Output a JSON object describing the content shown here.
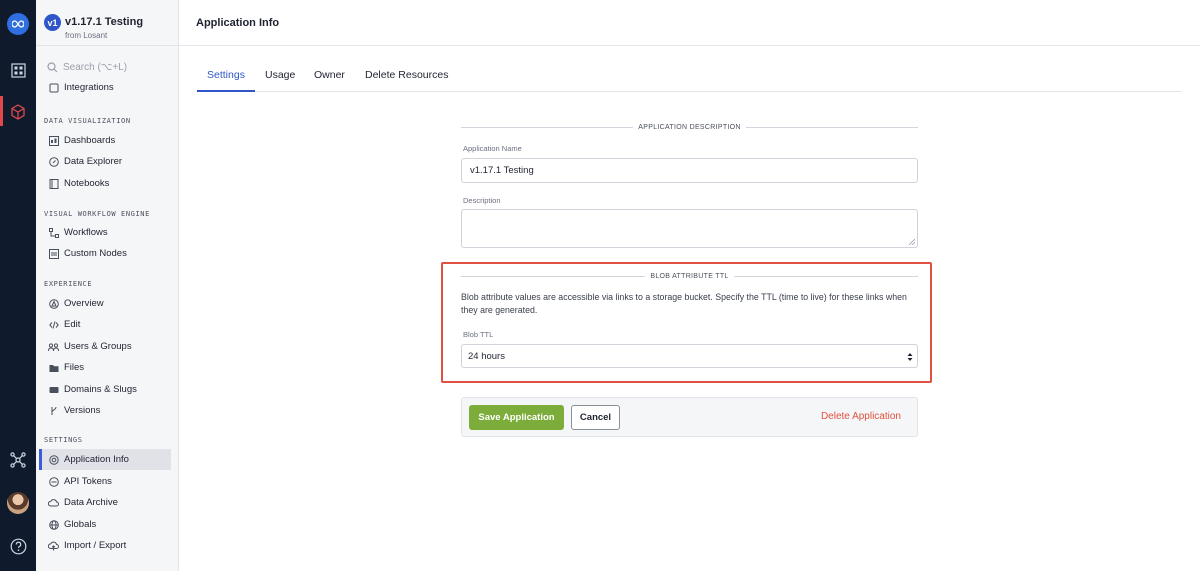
{
  "app": {
    "badge": "v1",
    "name": "v1.17.1 Testing",
    "owner": "from Losant"
  },
  "search": {
    "placeholder": "Search (⌥+L)"
  },
  "sidebar": {
    "partial_item": "Integrations",
    "sections": {
      "data_visualization": "DATA VISUALIZATION",
      "visual_workflow": "VISUAL WORKFLOW ENGINE",
      "experience": "EXPERIENCE",
      "settings": "SETTINGS"
    },
    "items": {
      "dashboards": "Dashboards",
      "data_explorer": "Data Explorer",
      "notebooks": "Notebooks",
      "workflows": "Workflows",
      "custom_nodes": "Custom Nodes",
      "overview": "Overview",
      "edit": "Edit",
      "users_groups": "Users & Groups",
      "files": "Files",
      "domains_slugs": "Domains & Slugs",
      "versions": "Versions",
      "application_info": "Application Info",
      "api_tokens": "API Tokens",
      "data_archive": "Data Archive",
      "globals": "Globals",
      "import_export": "Import / Export"
    }
  },
  "header": {
    "title": "Application Info"
  },
  "tabs": {
    "settings": "Settings",
    "usage": "Usage",
    "owner": "Owner",
    "delete_resources": "Delete Resources"
  },
  "form": {
    "section_description": "APPLICATION DESCRIPTION",
    "app_name_label": "Application Name",
    "app_name_value": "v1.17.1 Testing",
    "description_label": "Description",
    "description_value": "",
    "section_blob": "BLOB ATTRIBUTE TTL",
    "blob_help": "Blob attribute values are accessible via links to a storage bucket. Specify the TTL (time to live) for these links when they are generated.",
    "blob_ttl_label": "Blob TTL",
    "blob_ttl_value": "24 hours"
  },
  "actions": {
    "save": "Save Application",
    "cancel": "Cancel",
    "delete": "Delete Application"
  },
  "colors": {
    "rail": "#0f1b2d",
    "accent": "#2f56c8",
    "save": "#7cad3a",
    "danger": "#e0523f",
    "highlight": "#e0523f"
  }
}
